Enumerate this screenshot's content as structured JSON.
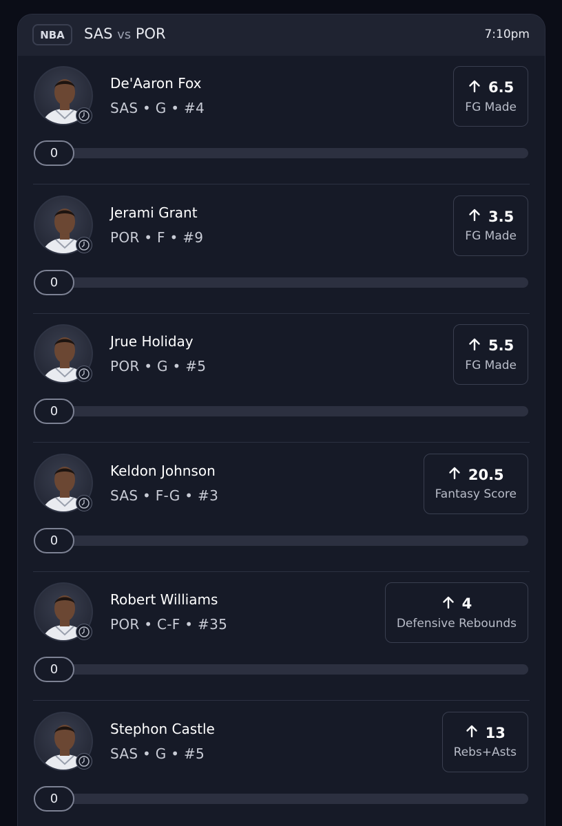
{
  "game": {
    "league": "NBA",
    "home": "SAS",
    "vs": "vs",
    "away": "POR",
    "time": "7:10pm"
  },
  "players": [
    {
      "name": "De'Aaron Fox",
      "meta": "SAS • G • #4",
      "line": "6.5",
      "stat": "FG Made",
      "progress": "0",
      "progress_fraction": 0,
      "jersey_color": "#e9ebf0"
    },
    {
      "name": "Jerami Grant",
      "meta": "POR • F • #9",
      "line": "3.5",
      "stat": "FG Made",
      "progress": "0",
      "progress_fraction": 0,
      "jersey_color": "#e9ebf0"
    },
    {
      "name": "Jrue Holiday",
      "meta": "POR • G • #5",
      "line": "5.5",
      "stat": "FG Made",
      "progress": "0",
      "progress_fraction": 0,
      "jersey_color": "#e9ebf0"
    },
    {
      "name": "Keldon Johnson",
      "meta": "SAS • F-G • #3",
      "line": "20.5",
      "stat": "Fantasy Score",
      "progress": "0",
      "progress_fraction": 0,
      "jersey_color": "#e9ebf0"
    },
    {
      "name": "Robert Williams",
      "meta": "POR • C-F • #35",
      "line": "4",
      "stat": "Defensive Rebounds",
      "progress": "0",
      "progress_fraction": 0,
      "jersey_color": "#e9ebf0"
    },
    {
      "name": "Stephon Castle",
      "meta": "SAS • G • #5",
      "line": "13",
      "stat": "Rebs+Asts",
      "progress": "0",
      "progress_fraction": 0,
      "jersey_color": "#e9ebf0"
    }
  ],
  "icons": {
    "pick_direction": "arrow-up-icon",
    "avatar_badge": "clock-icon"
  }
}
